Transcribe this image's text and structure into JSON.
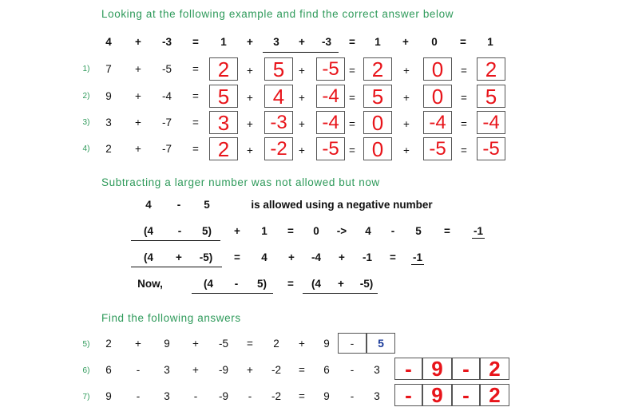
{
  "intro_text": "Looking at the following example and find the correct answer below",
  "example_row": [
    "4",
    "+",
    "-3",
    "=",
    "1",
    "+",
    "3",
    "+",
    "-3",
    "=",
    "1",
    "+",
    "0",
    "=",
    "1"
  ],
  "exercises": [
    {
      "number": "1)",
      "a": "7",
      "op": "+",
      "b": "-5",
      "eq": "=",
      "answers": [
        "2",
        "5",
        "-5",
        "2",
        "0",
        "2"
      ]
    },
    {
      "number": "2)",
      "a": "9",
      "op": "+",
      "b": "-4",
      "eq": "=",
      "answers": [
        "5",
        "4",
        "-4",
        "5",
        "0",
        "5"
      ]
    },
    {
      "number": "3)",
      "a": "3",
      "op": "+",
      "b": "-7",
      "eq": "=",
      "answers": [
        "3",
        "-3",
        "-4",
        "0",
        "-4",
        "-4"
      ]
    },
    {
      "number": "4)",
      "a": "2",
      "op": "+",
      "b": "-7",
      "eq": "=",
      "answers": [
        "2",
        "-2",
        "-5",
        "0",
        "-5",
        "-5"
      ]
    }
  ],
  "box_ops": [
    "+",
    "+",
    "=",
    "+",
    "="
  ],
  "subtract_text": "Subtracting a larger number was not allowed  but now",
  "allowed_line": {
    "a": "4",
    "op": "-",
    "b": "5",
    "text": "is allowed using a negative number"
  },
  "eq1": [
    "(4",
    "-",
    "5)",
    "+",
    "1",
    "=",
    "0",
    "->",
    "4",
    "-",
    "5",
    "=",
    "-1"
  ],
  "eq2": [
    "(4",
    "+",
    "-5)",
    "=",
    "4",
    "+",
    "-4",
    "+",
    "-1",
    "=",
    "-1"
  ],
  "now_line": {
    "label": "Now,",
    "left": [
      "(4",
      "-",
      "5)"
    ],
    "eq": "=",
    "right": [
      "(4",
      "+",
      "-5)"
    ]
  },
  "find_text": "Find the following answers",
  "q5": {
    "number": "5)",
    "tokens": [
      "2",
      "+",
      "9",
      "+",
      "-5",
      "=",
      "2",
      "+",
      "9"
    ],
    "box1": "-",
    "box2": "5"
  },
  "q6": {
    "number": "6)",
    "tokens": [
      "6",
      "-",
      "3",
      "+",
      "-9",
      "+",
      "-2",
      "=",
      "6",
      "-",
      "3"
    ],
    "answers": [
      "-",
      "9",
      "-",
      "2"
    ]
  },
  "q7": {
    "number": "7)",
    "tokens": [
      "9",
      "-",
      "3",
      "-",
      "-9",
      "-",
      "-2",
      "=",
      "9",
      "-",
      "3"
    ],
    "answers": [
      "-",
      "9",
      "-",
      "2"
    ]
  },
  "colors": {
    "heading": "#2e9a5a",
    "answer": "#e8141a",
    "blue": "#1a3a9a"
  }
}
